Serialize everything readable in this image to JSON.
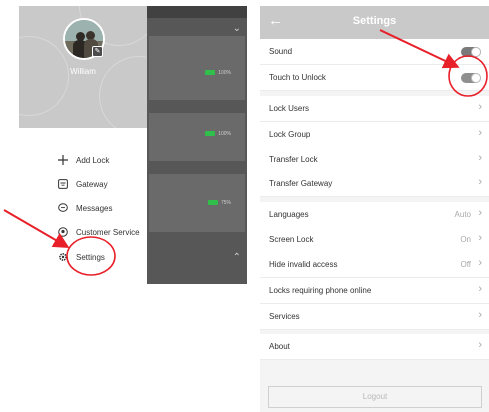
{
  "drawer": {
    "user_name": "William",
    "menu": [
      {
        "label": "Add Lock",
        "icon": "plus-icon"
      },
      {
        "label": "Gateway",
        "icon": "gateway-icon"
      },
      {
        "label": "Messages",
        "icon": "message-icon"
      },
      {
        "label": "Customer Service",
        "icon": "customer-service-icon"
      },
      {
        "label": "Settings",
        "icon": "gear-icon"
      }
    ]
  },
  "lock_list_battery": [
    "100%",
    "100%",
    "75%"
  ],
  "settings": {
    "title": "Settings",
    "sound": {
      "label": "Sound",
      "enabled": true
    },
    "touch_to_unlock": {
      "label": "Touch to Unlock",
      "enabled": true
    },
    "lock_users": "Lock Users",
    "lock_group": "Lock Group",
    "transfer_lock": "Transfer Lock",
    "transfer_gateway": "Transfer Gateway",
    "languages": {
      "label": "Languages",
      "value": "Auto"
    },
    "screen_lock": {
      "label": "Screen Lock",
      "value": "On"
    },
    "hide_invalid_access": {
      "label": "Hide invalid access",
      "value": "Off"
    },
    "locks_requiring_phone_online": "Locks requiring phone online",
    "services": "Services",
    "about": "About",
    "logout": "Logout"
  },
  "colors": {
    "header_gray": "#c9c9c9",
    "annotation_red": "#e8202a",
    "battery_green": "#2fbf4a"
  }
}
